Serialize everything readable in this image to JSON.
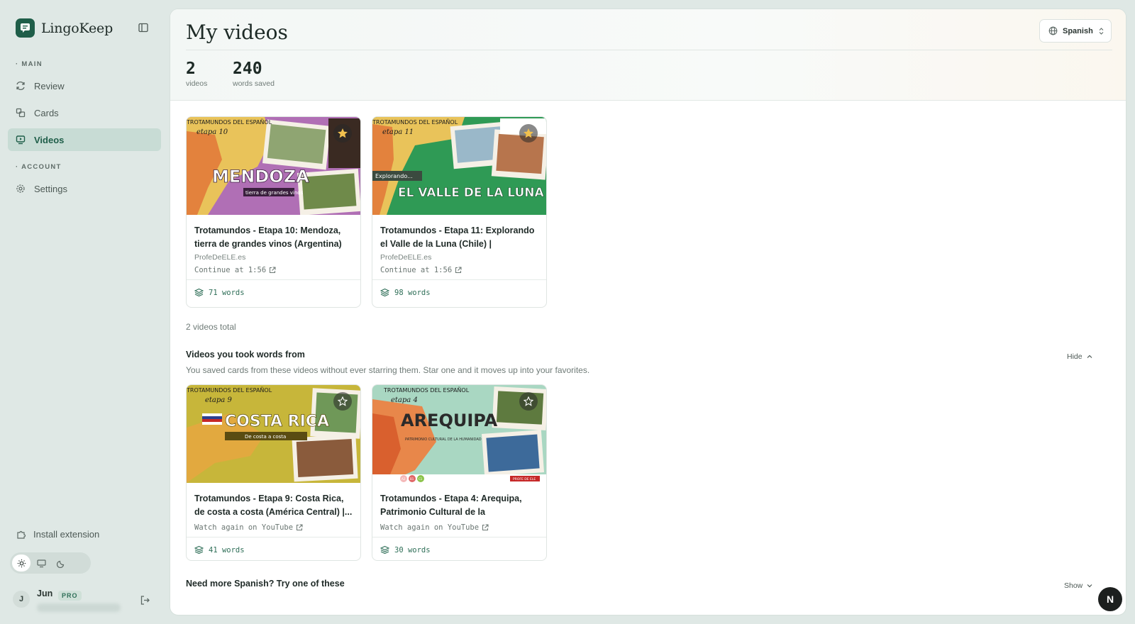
{
  "app": {
    "name": "LingoKeep"
  },
  "sidebar": {
    "sections": [
      {
        "label": "MAIN"
      },
      {
        "label": "ACCOUNT"
      }
    ],
    "items": [
      {
        "label": "Review",
        "icon": "review-icon"
      },
      {
        "label": "Cards",
        "icon": "cards-icon"
      },
      {
        "label": "Videos",
        "icon": "video-icon",
        "active": true
      },
      {
        "label": "Settings",
        "icon": "gear-icon"
      }
    ],
    "install_label": "Install extension",
    "theme_modes": [
      "light",
      "system",
      "dark"
    ],
    "active_theme": "light",
    "user": {
      "initial": "J",
      "name": "Jun",
      "badge": "PRO"
    }
  },
  "header": {
    "title": "My videos",
    "language": "Spanish",
    "stats": [
      {
        "value": "2",
        "label": "videos"
      },
      {
        "value": "240",
        "label": "words saved"
      }
    ]
  },
  "favorites": {
    "videos": [
      {
        "title": "Trotamundos - Etapa 10: Mendoza, tierra de grandes vinos (Argentina) |...",
        "channel": "ProfeDeELE.es",
        "continue": "Continue at 1:56",
        "words": "71 words",
        "starred": true,
        "thumb_text": "MENDOZA",
        "thumb_sub": "tierra de grandes vinos",
        "thumb_stage": "etapa 10",
        "thumb_header": "TROTAMUNDOS DEL ESPAÑOL"
      },
      {
        "title": "Trotamundos - Etapa 11: Explorando el Valle de la Luna (Chile) | ProfeDeELE",
        "channel": "ProfeDeELE.es",
        "continue": "Continue at 1:56",
        "words": "98 words",
        "starred": true,
        "thumb_text": "EL VALLE DE LA LUNA",
        "thumb_sub": "Explorando...",
        "thumb_stage": "etapa 11",
        "thumb_header": "TROTAMUNDOS DEL ESPAÑOL"
      }
    ],
    "total": "2 videos total"
  },
  "took_from": {
    "title": "Videos you took words from",
    "description": "You saved cards from these videos without ever starring them. Star one and it moves up into your favorites.",
    "toggle": "Hide",
    "videos": [
      {
        "title": "Trotamundos - Etapa 9: Costa Rica, de costa a costa (América Central) |...",
        "action": "Watch again on YouTube",
        "words": "41 words",
        "thumb_text": "COSTA RICA",
        "thumb_sub": "De costa a costa",
        "thumb_stage": "etapa 9",
        "thumb_header": "TROTAMUNDOS DEL ESPAÑOL"
      },
      {
        "title": "Trotamundos - Etapa 4: Arequipa, Patrimonio Cultural de la Humanidad...",
        "action": "Watch again on YouTube",
        "words": "30 words",
        "thumb_text": "AREQUIPA",
        "thumb_sub": "PATRIMONIO CULTURAL DE LA HUMANIDAD",
        "thumb_stage": "etapa 4",
        "thumb_header": "TROTAMUNDOS DEL ESPAÑOL",
        "thumb_levels": [
          "A2",
          "B1",
          "C1"
        ],
        "thumb_brand": "PROFE DE ELE"
      }
    ]
  },
  "suggest": {
    "title": "Need more Spanish? Try one of these",
    "toggle": "Show"
  },
  "fab_label": "N"
}
